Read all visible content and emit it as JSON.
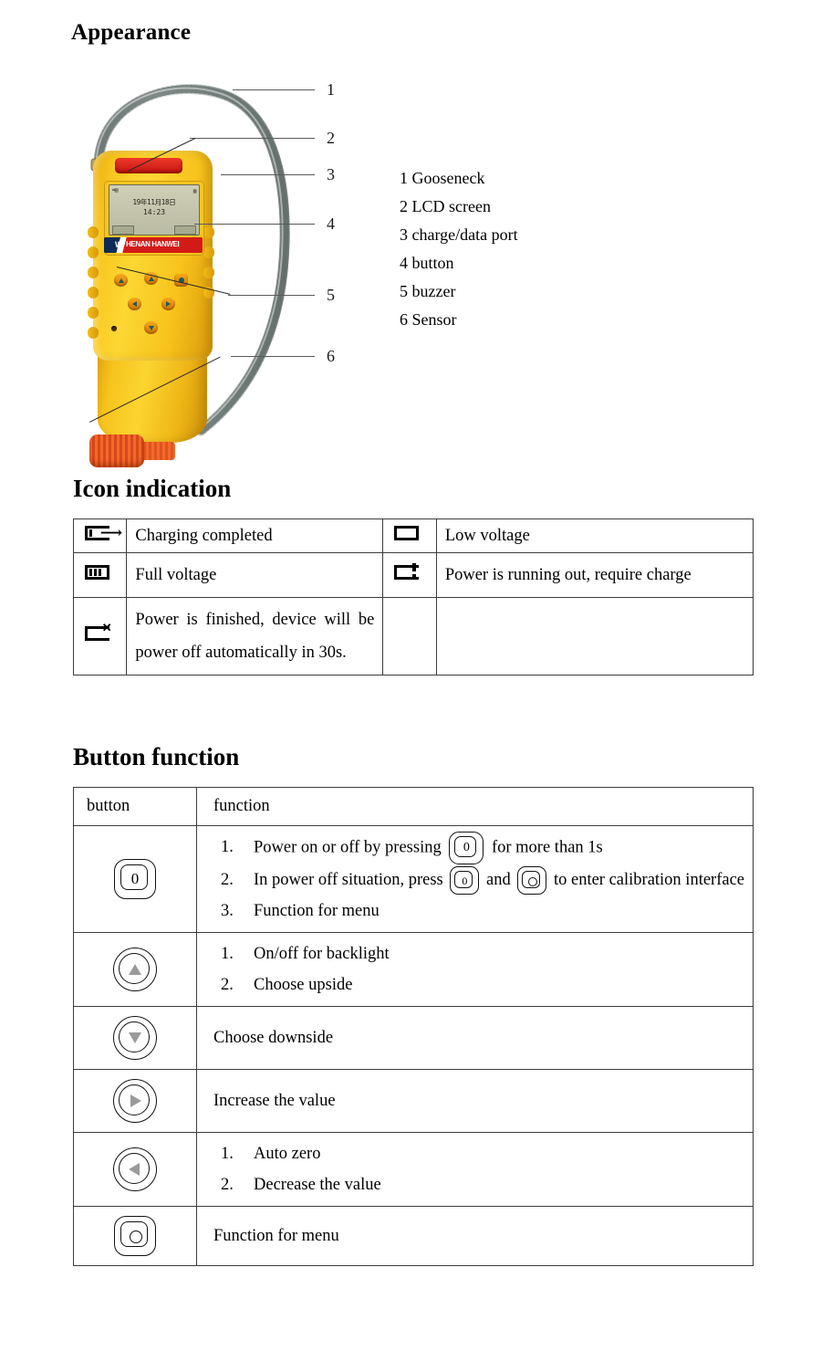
{
  "sections": {
    "appearance": {
      "heading": "Appearance",
      "callout_numbers": [
        "1",
        "2",
        "3",
        "4",
        "5",
        "6"
      ],
      "legend": [
        "1 Gooseneck",
        "2 LCD screen",
        "3 charge/data port",
        "4 button",
        "5 buzzer",
        "6 Sensor"
      ],
      "device": {
        "lcd": {
          "status_left": "⌗▤",
          "status_right": "▧",
          "date": "19年11月18日",
          "time": "14:23"
        },
        "brand": {
          "mark": "W",
          "text": "HENAN HANWEI"
        }
      }
    },
    "icon_indication": {
      "heading": "Icon indication",
      "rows": [
        {
          "left_icon": "battery-charging-complete-icon",
          "left_text": "Charging completed",
          "right_icon": "battery-empty-icon",
          "right_text": "Low voltage"
        },
        {
          "left_icon": "battery-full-icon",
          "left_text": "Full voltage",
          "right_icon": "battery-warning-icon",
          "right_text": "Power is running out, require charge"
        },
        {
          "left_icon": "battery-dead-icon",
          "left_text": "Power is finished, device will be power off automatically in 30s.",
          "right_icon": "",
          "right_text": ""
        }
      ]
    },
    "button_function": {
      "heading": "Button function",
      "header": {
        "button": "button",
        "function": "function"
      },
      "rows": [
        {
          "icon": "power-button-icon",
          "icon_glyph": "0",
          "items": [
            {
              "marker": "1.",
              "parts": [
                "Power on or off by pressing ",
                "[power-button-icon]",
                " for more than 1s"
              ]
            },
            {
              "marker": "2.",
              "parts": [
                "In power off situation, press ",
                "[power-button-icon]",
                " and ",
                "[menu-button-icon]",
                " to enter calibration interface"
              ]
            },
            {
              "marker": "3.",
              "parts": [
                "Function for menu"
              ]
            }
          ],
          "text_1": "Power on or off by pressing",
          "text_1b": "for more than 1s",
          "text_2a": "In power off situation, press",
          "text_2b": "and",
          "text_2c": "to enter calibration interface",
          "text_3": "Function for menu"
        },
        {
          "icon": "up-button-icon",
          "items": [
            {
              "marker": "1.",
              "text": "On/off for backlight"
            },
            {
              "marker": "2.",
              "text": "Choose upside"
            }
          ]
        },
        {
          "icon": "down-button-icon",
          "plain": "Choose downside"
        },
        {
          "icon": "right-button-icon",
          "plain": "Increase the value"
        },
        {
          "icon": "left-button-icon",
          "items": [
            {
              "marker": "1.",
              "text": "Auto zero"
            },
            {
              "marker": "2.",
              "text": "Decrease the value"
            }
          ]
        },
        {
          "icon": "menu-button-icon",
          "plain": "Function for menu"
        }
      ]
    }
  },
  "colors": {
    "device_yellow": "#fcd330",
    "device_red": "#d41a17",
    "sensor_orange": "#f4692a",
    "lcd_green": "#c6c8ae",
    "border": "#3c3c3c",
    "text": "#000000"
  }
}
